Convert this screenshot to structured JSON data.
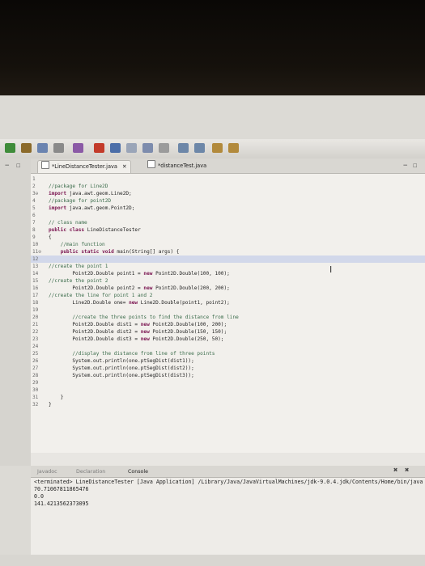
{
  "editor": {
    "tabs": [
      {
        "label": "*LineDistanceTester.java",
        "close": "✕"
      },
      {
        "label": "*distanceTest.java"
      }
    ],
    "lines": [
      {
        "n": "1",
        "t": ""
      },
      {
        "n": "2",
        "t": "//package for Line2D"
      },
      {
        "n": "3⊖",
        "t": "import java.awt.geom.Line2D;"
      },
      {
        "n": "4",
        "t": "//package for point2D"
      },
      {
        "n": "5",
        "t": "import java.awt.geom.Point2D;"
      },
      {
        "n": "6",
        "t": ""
      },
      {
        "n": "7",
        "t": "// class name"
      },
      {
        "n": "8",
        "t": "public class LineDistanceTester"
      },
      {
        "n": "9",
        "t": "{"
      },
      {
        "n": "10",
        "t": "    //main function"
      },
      {
        "n": "11⊖",
        "t": "    public static void main(String[] args) {"
      },
      {
        "n": "12",
        "t": ""
      },
      {
        "n": "13",
        "t": "//create the point 1"
      },
      {
        "n": "14",
        "t": "        Point2D.Double point1 = new Point2D.Double(100, 100);"
      },
      {
        "n": "15",
        "t": "//create the point 2"
      },
      {
        "n": "16",
        "t": "        Point2D.Double point2 = new Point2D.Double(200, 200);"
      },
      {
        "n": "17",
        "t": "//create the line for point 1 and 2"
      },
      {
        "n": "18",
        "t": "        Line2D.Double one= new Line2D.Double(point1, point2);"
      },
      {
        "n": "19",
        "t": ""
      },
      {
        "n": "20",
        "t": "        //create the three points to find the distance from line"
      },
      {
        "n": "21",
        "t": "        Point2D.Double dist1 = new Point2D.Double(100, 200);"
      },
      {
        "n": "22",
        "t": "        Point2D.Double dist2 = new Point2D.Double(150, 150);"
      },
      {
        "n": "23",
        "t": "        Point2D.Double dist3 = new Point2D.Double(250, 50);"
      },
      {
        "n": "24",
        "t": ""
      },
      {
        "n": "25",
        "t": "        //display the distance from line of three points"
      },
      {
        "n": "26",
        "t": "        System.out.println(one.ptSegDist(dist1));"
      },
      {
        "n": "27",
        "t": "        System.out.println(one.ptSegDist(dist2));"
      },
      {
        "n": "28",
        "t": "        System.out.println(one.ptSegDist(dist3));"
      },
      {
        "n": "29",
        "t": ""
      },
      {
        "n": "30",
        "t": ""
      },
      {
        "n": "31",
        "t": "    }"
      },
      {
        "n": "32",
        "t": "}"
      }
    ]
  },
  "console": {
    "tabs": [
      "Javadoc",
      "Declaration",
      "Console"
    ],
    "header": "<terminated> LineDistanceTester [Java Application] /Library/Java/JavaVirtualMachines/jdk-9.0.4.jdk/Contents/Home/bin/java (Mar 28, 2",
    "output": [
      "70.71067811865476",
      "0.0",
      "141.4213562373095"
    ]
  },
  "colors": {
    "keyword": "#7a1450",
    "comment": "#3a6b4a",
    "highlight": "#d2d8ea"
  }
}
